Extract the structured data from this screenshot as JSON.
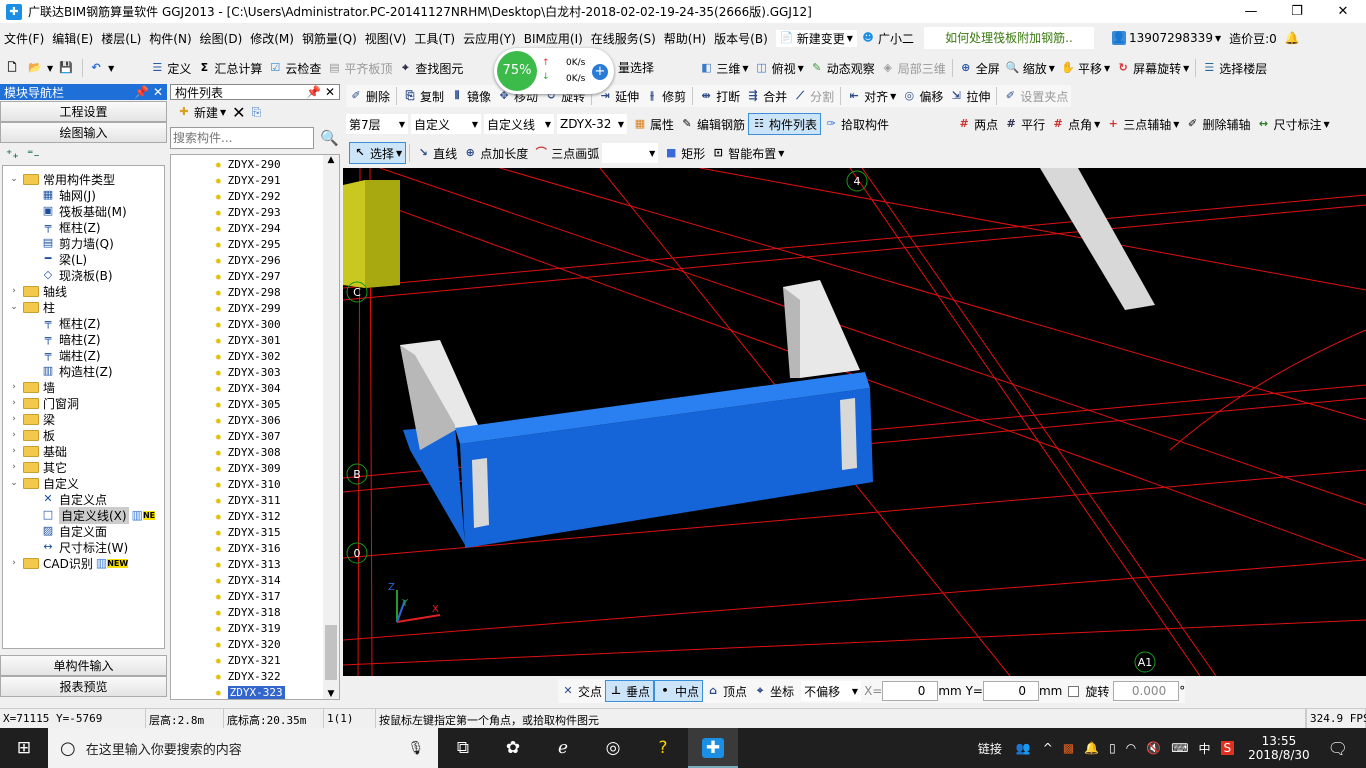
{
  "title": "广联达BIM钢筋算量软件 GGJ2013 - [C:\\Users\\Administrator.PC-20141127NRHM\\Desktop\\白龙村-2018-02-02-19-24-35(2666版).GGJ12]",
  "menu": [
    "文件(F)",
    "编辑(E)",
    "楼层(L)",
    "构件(N)",
    "绘图(D)",
    "修改(M)",
    "钢筋量(Q)",
    "视图(V)",
    "工具(T)",
    "云应用(Y)",
    "BIM应用(I)",
    "在线服务(S)",
    "帮助(H)",
    "版本号(B)"
  ],
  "menu_extra": {
    "new_change": "新建变更",
    "assistant": "广小二",
    "tip": "如何处理筏板附加钢筋..",
    "account": "13907298339",
    "beans": "造价豆:0"
  },
  "toolbar1": {
    "define": "定义",
    "sum": "汇总计算",
    "cloud_check": "云检查",
    "align_top": "平齐板顶",
    "find": "查找图元",
    "batch_select": "量选择",
    "three_d": "三维",
    "top_view": "俯视",
    "dynamic": "动态观察",
    "local_3d": "局部三维",
    "fullscreen": "全屏",
    "zoom": "缩放",
    "pan": "平移",
    "rotate_screen": "屏幕旋转",
    "select_floor": "选择楼层"
  },
  "net_widget": {
    "percent": "75%",
    "up": "0K/s",
    "down": "0K/s"
  },
  "toolbar2": [
    "删除",
    "复制",
    "镜像",
    "移动",
    "旋转",
    "延伸",
    "修剪",
    "打断",
    "合并",
    "分割",
    "对齐",
    "偏移",
    "拉伸",
    "设置夹点"
  ],
  "toolbar3": {
    "floor": "第7层",
    "type": "自定义",
    "subtype": "自定义线",
    "component": "ZDYX-32",
    "props": "属性",
    "edit_rebar": "编辑钢筋",
    "comp_list": "构件列表",
    "pick": "拾取构件",
    "two_point": "两点",
    "parallel": "平行",
    "point_angle": "点角",
    "three_axis": "三点辅轴",
    "del_axis": "删除辅轴",
    "dim": "尺寸标注"
  },
  "toolbar4": {
    "select": "选择",
    "line": "直线",
    "point_len": "点加长度",
    "arc": "三点画弧",
    "rect": "矩形",
    "smart": "智能布置"
  },
  "nav": {
    "title": "模块导航栏",
    "project_settings": "工程设置",
    "drawing_input": "绘图输入",
    "single_input": "单构件输入",
    "report": "报表预览",
    "tree": [
      {
        "label": "常用构件类型",
        "level": 0,
        "open": true,
        "folder": true
      },
      {
        "label": "轴网(J)",
        "level": 1,
        "icon": "▦"
      },
      {
        "label": "筏板基础(M)",
        "level": 1,
        "icon": "▣"
      },
      {
        "label": "框柱(Z)",
        "level": 1,
        "icon": "╤"
      },
      {
        "label": "剪力墙(Q)",
        "level": 1,
        "icon": "▤"
      },
      {
        "label": "梁(L)",
        "level": 1,
        "icon": "━"
      },
      {
        "label": "现浇板(B)",
        "level": 1,
        "icon": "◇"
      },
      {
        "label": "轴线",
        "level": 0,
        "folder": true
      },
      {
        "label": "柱",
        "level": 0,
        "open": true,
        "folder": true
      },
      {
        "label": "框柱(Z)",
        "level": 1,
        "icon": "╤"
      },
      {
        "label": "暗柱(Z)",
        "level": 1,
        "icon": "╤"
      },
      {
        "label": "端柱(Z)",
        "level": 1,
        "icon": "╤"
      },
      {
        "label": "构造柱(Z)",
        "level": 1,
        "icon": "▥"
      },
      {
        "label": "墙",
        "level": 0,
        "folder": true
      },
      {
        "label": "门窗洞",
        "level": 0,
        "folder": true
      },
      {
        "label": "梁",
        "level": 0,
        "folder": true
      },
      {
        "label": "板",
        "level": 0,
        "folder": true
      },
      {
        "label": "基础",
        "level": 0,
        "folder": true
      },
      {
        "label": "其它",
        "level": 0,
        "folder": true
      },
      {
        "label": "自定义",
        "level": 0,
        "open": true,
        "folder": true
      },
      {
        "label": "自定义点",
        "level": 1,
        "icon": "✕"
      },
      {
        "label": "自定义线(X)",
        "level": 1,
        "icon": "□",
        "selected": true,
        "badge": "NE"
      },
      {
        "label": "自定义面",
        "level": 1,
        "icon": "▨"
      },
      {
        "label": "尺寸标注(W)",
        "level": 1,
        "icon": "↔"
      },
      {
        "label": "CAD识别",
        "level": 0,
        "folder": true,
        "badge": "NEW"
      }
    ]
  },
  "complist": {
    "title": "构件列表",
    "new": "新建",
    "search_placeholder": "搜索构件...",
    "items": [
      "ZDYX-290",
      "ZDYX-291",
      "ZDYX-292",
      "ZDYX-293",
      "ZDYX-294",
      "ZDYX-295",
      "ZDYX-296",
      "ZDYX-297",
      "ZDYX-298",
      "ZDYX-299",
      "ZDYX-300",
      "ZDYX-301",
      "ZDYX-302",
      "ZDYX-303",
      "ZDYX-304",
      "ZDYX-305",
      "ZDYX-306",
      "ZDYX-307",
      "ZDYX-308",
      "ZDYX-309",
      "ZDYX-310",
      "ZDYX-311",
      "ZDYX-312",
      "ZDYX-315",
      "ZDYX-316",
      "ZDYX-313",
      "ZDYX-314",
      "ZDYX-317",
      "ZDYX-318",
      "ZDYX-319",
      "ZDYX-320",
      "ZDYX-321",
      "ZDYX-322",
      "ZDYX-323"
    ],
    "selected": "ZDYX-323"
  },
  "viewport": {
    "axis_labels": [
      "4",
      "C",
      "B",
      "0",
      "A1"
    ],
    "axes": [
      "Z",
      "Y",
      "X"
    ]
  },
  "snapbar": {
    "intersect": "交点",
    "perp": "垂点",
    "mid": "中点",
    "vertex": "顶点",
    "coord": "坐标",
    "offset": "不偏移",
    "x_label": "X=",
    "x": "0",
    "mm1": "mm",
    "y_label": "Y=",
    "y": "0",
    "mm2": "mm",
    "rotate": "旋转",
    "angle": "0.000",
    "deg": "°"
  },
  "status": {
    "coords": "X=71115 Y=-5769",
    "floor_h": "层高:2.8m",
    "base_h": "底标高:20.35m",
    "count": "1(1)",
    "hint": "按鼠标左键指定第一个角点，或拾取构件图元",
    "fps": "324.9 FPS"
  },
  "taskbar": {
    "search": "在这里输入你要搜索的内容",
    "link": "链接",
    "ime": "中",
    "time": "13:55",
    "date": "2018/8/30"
  }
}
